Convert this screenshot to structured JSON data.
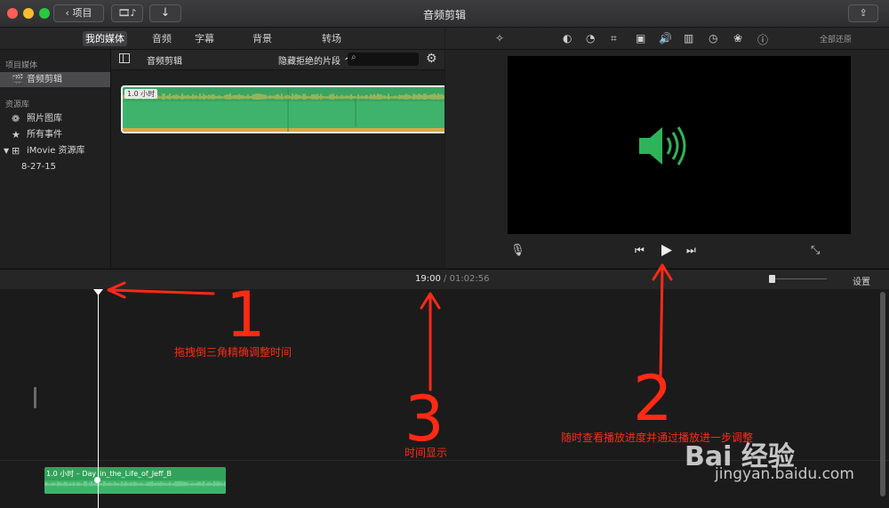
{
  "window": {
    "title": "音频剪辑",
    "back_button": "项目"
  },
  "browser_tabs": [
    "我的媒体",
    "音频",
    "字幕",
    "背景",
    "转场"
  ],
  "sidebar": {
    "project_media_heading": "项目媒体",
    "project_item": "音频剪辑",
    "libraries_heading": "资源库",
    "items": [
      "照片图库",
      "所有事件",
      "iMovie 资源库",
      "8-27-15"
    ]
  },
  "browser": {
    "title": "音频剪辑",
    "filter_label": "隐藏拒绝的片段",
    "search_placeholder": "",
    "clip_duration": "1.0 小时"
  },
  "viewer": {
    "reset_all": "全部还原"
  },
  "timeline": {
    "current_time": "19:00",
    "separator": "/",
    "total_time": "01:02:56",
    "settings_label": "设置",
    "clip_label": "1.0 小时 – Day_in_the_Life_of_Jeff_B"
  },
  "annotations": {
    "drag_tip": "拖拽倒三角精确调整时间",
    "time_tip": "时间显示",
    "play_tip": "随时查看播放进度并通过播放进一步调整",
    "num1": "1",
    "num2": "2",
    "num3": "3"
  },
  "watermark": {
    "site": "jingyan.baidu.com",
    "brand": "Bai 经验"
  },
  "colors": {
    "accent_green": "#3fb36b",
    "annotation_red": "#ff2a14",
    "speaker_green": "#2fb35a"
  }
}
